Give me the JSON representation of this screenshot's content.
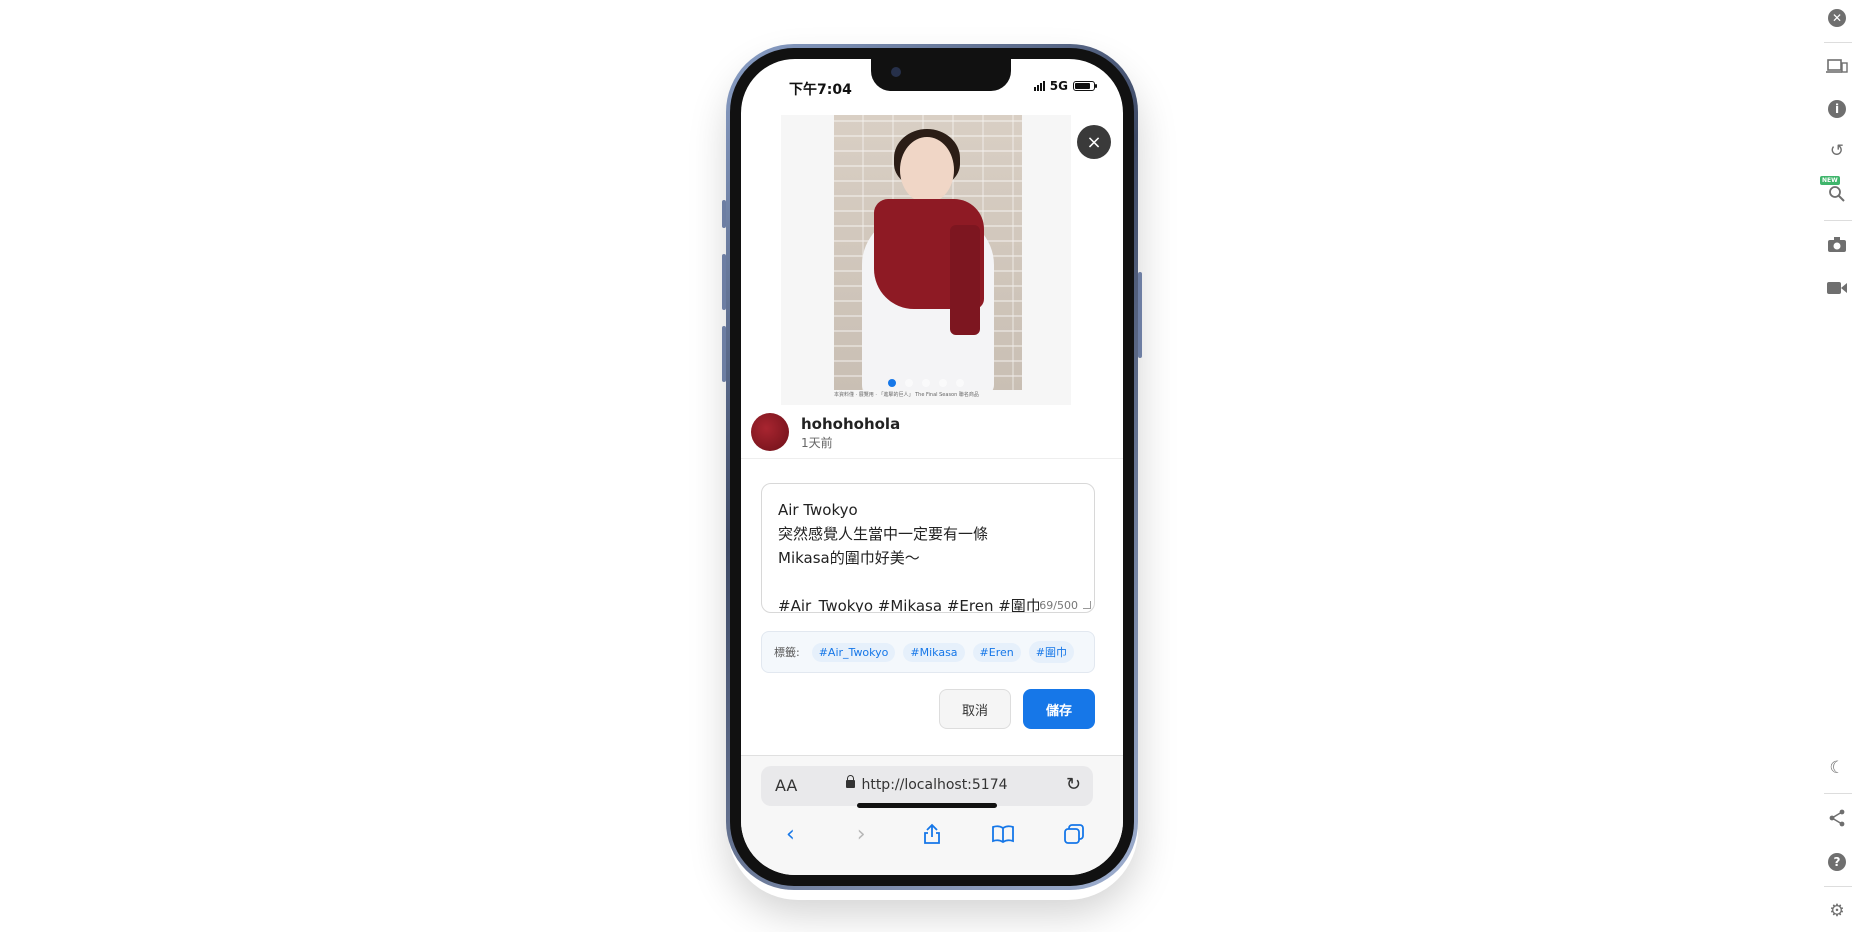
{
  "status_bar": {
    "time": "下午7:04",
    "network": "5G"
  },
  "post": {
    "author": "hohohohola",
    "time_ago": "1天前",
    "photo_caption": "本資料僅 · 展覽用 · 「進擊的巨人」 The Final Season 聯名商品",
    "caption_lines": [
      "Air Twokyo",
      "突然感覺人生當中一定要有一條",
      "Mikasa的圍巾好美〜",
      "",
      "#Air_Twokyo #Mikasa #Eren #圍巾"
    ],
    "char_count": "69/500",
    "tags_label": "標籤:",
    "tags": [
      "#Air_Twokyo",
      "#Mikasa",
      "#Eren",
      "#圍巾"
    ],
    "carousel_dots": 5,
    "carousel_active": 0
  },
  "actions": {
    "cancel_label": "取消",
    "save_label": "儲存",
    "close_label": "×"
  },
  "browser": {
    "text_size_label": "AA",
    "url": "http://localhost:5174",
    "icons": [
      "chevron-left-icon",
      "chevron-right-icon",
      "share-icon",
      "bookmarks-icon",
      "tabs-icon"
    ]
  },
  "right_panel": {
    "new_badge": "NEW"
  },
  "colors": {
    "accent": "#1677e8",
    "scarf": "#8e1a24",
    "text": "#222222"
  }
}
